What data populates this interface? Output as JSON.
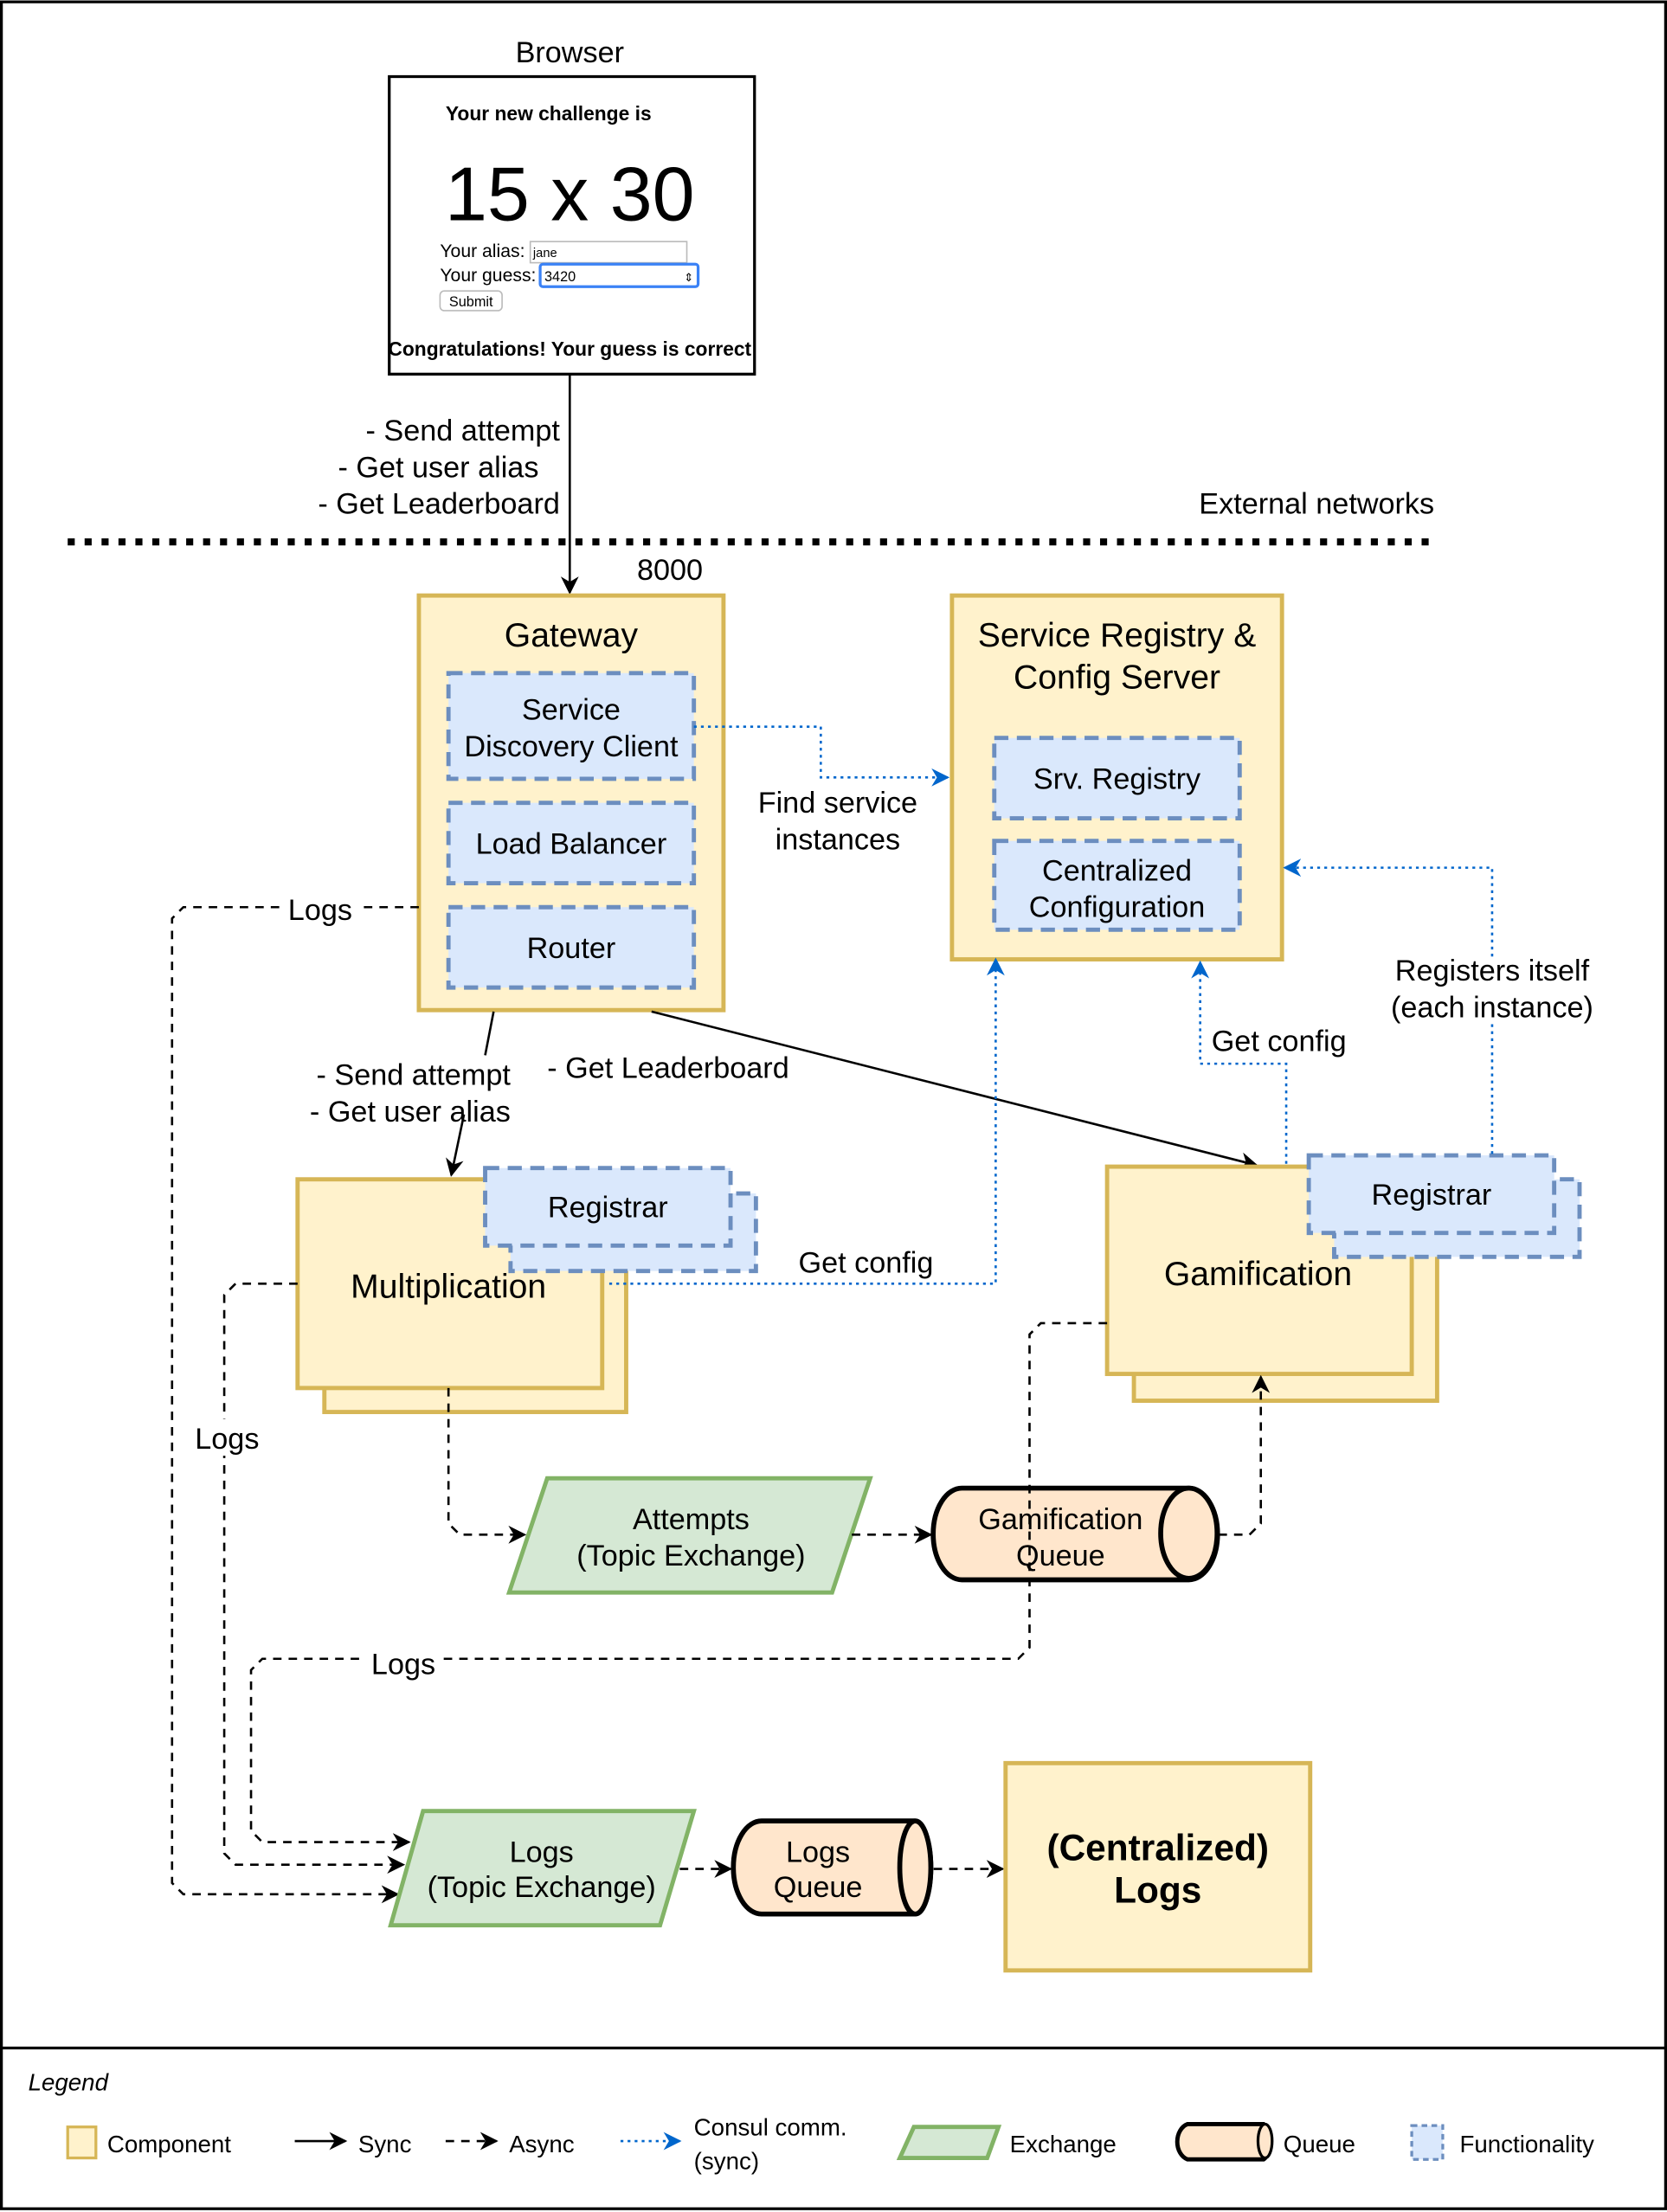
{
  "browser": {
    "label": "Browser",
    "heading": "Your new challenge is",
    "challenge": "15 x 30",
    "alias_label": "Your alias:",
    "alias_value": "jane",
    "guess_label": "Your guess:",
    "guess_value": "3420",
    "submit_label": "Submit",
    "result": "Congratulations! Your guess is correct"
  },
  "edges": {
    "browser_to_gateway": [
      "- Send attempt",
      "- Get user alias",
      "- Get Leaderboard"
    ],
    "external_networks": "External networks",
    "port": "8000",
    "find_service": [
      "Find service",
      "instances"
    ],
    "logs": "Logs",
    "gateway_to_mult": [
      "- Send attempt",
      "- Get user alias"
    ],
    "gateway_to_gam": "- Get Leaderboard",
    "get_config": "Get config",
    "registers": [
      "Registers itself",
      "(each instance)"
    ]
  },
  "nodes": {
    "gateway": "Gateway",
    "service_discovery": [
      "Service",
      "Discovery Client"
    ],
    "load_balancer": "Load Balancer",
    "router": "Router",
    "registry": [
      "Service Registry &",
      "Config Server"
    ],
    "srv_registry": "Srv. Registry",
    "central_config": [
      "Centralized",
      "Configuration"
    ],
    "multiplication": "Multiplication",
    "gamification": "Gamification",
    "registrar": "Registrar",
    "attempts_exchange": [
      "Attempts",
      "(Topic Exchange)"
    ],
    "gamification_queue": [
      "Gamification",
      "Queue"
    ],
    "logs_exchange": [
      "Logs",
      "(Topic Exchange)"
    ],
    "logs_queue": [
      "Logs",
      "Queue"
    ],
    "central_logs": [
      "(Centralized)",
      "Logs"
    ]
  },
  "legend": {
    "title": "Legend",
    "items": [
      "Component",
      "Sync",
      "Async",
      "Consul comm.",
      "(sync)",
      "Exchange",
      "Queue",
      "Functionality"
    ]
  },
  "colors": {
    "component_fill": "#fff2cc",
    "component_stroke": "#d6b656",
    "functionality_fill": "#dae8fc",
    "functionality_stroke": "#6c8ebf",
    "exchange_fill": "#d5e8d4",
    "exchange_stroke": "#82b366",
    "queue_fill": "#ffe6cc",
    "consul_line": "#0066cc"
  }
}
